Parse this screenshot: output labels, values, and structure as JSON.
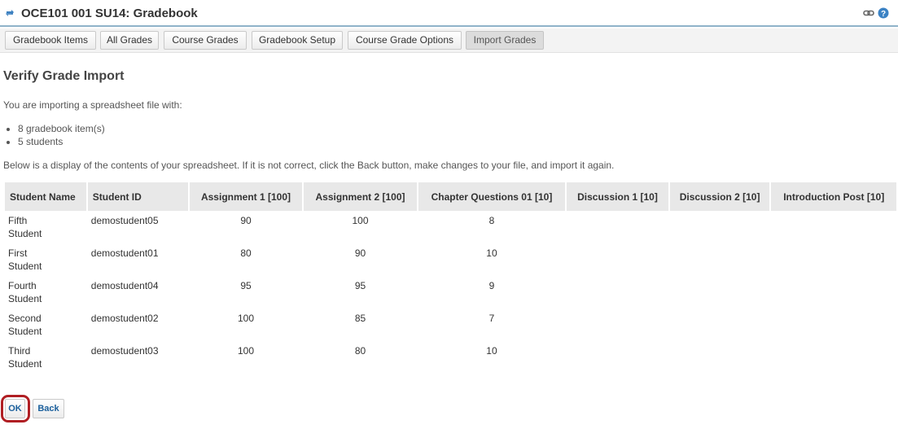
{
  "header": {
    "title": "OCE101 001 SU14: Gradebook",
    "reset_icon": "reset-arrows-icon",
    "link_icon": "link-icon",
    "help_icon": "help-icon"
  },
  "nav": {
    "items": [
      {
        "label": "Gradebook Items"
      },
      {
        "label": "All Grades"
      },
      {
        "label": "Course Grades"
      },
      {
        "label": "Gradebook Setup"
      },
      {
        "label": "Course Grade Options"
      },
      {
        "label": "Import Grades",
        "current": true
      }
    ]
  },
  "page": {
    "heading": "Verify Grade Import",
    "intro": "You are importing a spreadsheet file with:",
    "summary": [
      "8 gradebook item(s)",
      "5 students"
    ],
    "below": "Below is a display of the contents of your spreadsheet. If it is not correct, click the Back button, make changes to your file, and import it again."
  },
  "table": {
    "headers": [
      "Student Name",
      "Student ID",
      "Assignment 1 [100]",
      "Assignment 2 [100]",
      "Chapter Questions 01 [10]",
      "Discussion 1 [10]",
      "Discussion 2 [10]",
      "Introduction Post [10]"
    ],
    "rows": [
      {
        "first": "Fifth",
        "last": "Student",
        "id": "demostudent05",
        "a1": "90",
        "a2": "100",
        "cq": "8"
      },
      {
        "first": "First",
        "last": "Student",
        "id": "demostudent01",
        "a1": "80",
        "a2": "90",
        "cq": "10"
      },
      {
        "first": "Fourth",
        "last": "Student",
        "id": "demostudent04",
        "a1": "95",
        "a2": "95",
        "cq": "9"
      },
      {
        "first": "Second",
        "last": "Student",
        "id": "demostudent02",
        "a1": "100",
        "a2": "85",
        "cq": "7"
      },
      {
        "first": "Third",
        "last": "Student",
        "id": "demostudent03",
        "a1": "100",
        "a2": "80",
        "cq": "10"
      }
    ]
  },
  "actions": {
    "ok_label": "OK",
    "back_label": "Back"
  },
  "colors": {
    "accent": "#8fb3c9",
    "highlight": "#b01e23",
    "link": "#1a5f9c"
  }
}
